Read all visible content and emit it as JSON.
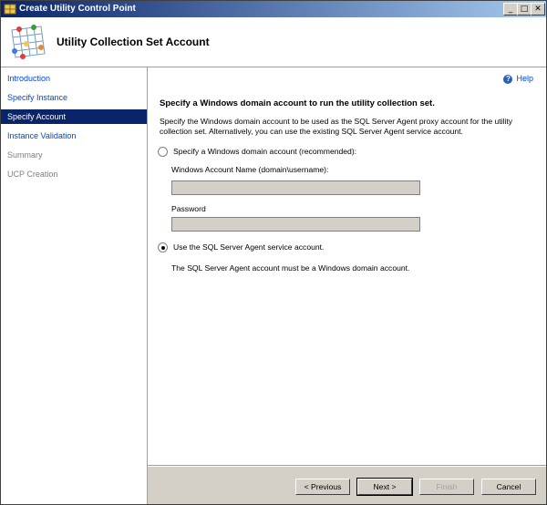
{
  "window": {
    "title": "Create Utility Control Point",
    "controls": {
      "minimize": "_",
      "maximize": "□",
      "close": "✕"
    }
  },
  "header": {
    "title": "Utility Collection Set Account"
  },
  "nav": {
    "items": [
      {
        "label": "Introduction",
        "state": "link"
      },
      {
        "label": "Specify Instance",
        "state": "link"
      },
      {
        "label": "Specify Account",
        "state": "selected"
      },
      {
        "label": "Instance Validation",
        "state": "link"
      },
      {
        "label": "Summary",
        "state": "disabled"
      },
      {
        "label": "UCP Creation",
        "state": "disabled"
      }
    ]
  },
  "help": {
    "icon": "?",
    "label": "Help"
  },
  "main": {
    "heading": "Specify a Windows domain account to run the utility collection set.",
    "description": "Specify the Windows domain account to be used as the SQL Server Agent proxy account for the utility collection set. Alternatively, you can use the existing SQL Server Agent service account.",
    "option_domain": "Specify a Windows domain account (recommended):",
    "account_label": "Windows Account Name (domain\\username):",
    "account_value": "",
    "password_label": "Password",
    "password_value": "",
    "option_agent": "Use the SQL Server Agent service account.",
    "note": "The SQL Server Agent account must be a Windows domain account."
  },
  "buttons": {
    "previous": "< Previous",
    "next": "Next >",
    "finish": "Finish",
    "cancel": "Cancel"
  }
}
